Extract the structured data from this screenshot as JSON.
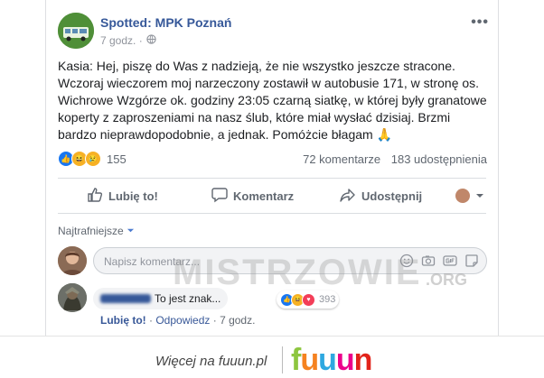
{
  "post": {
    "page_name": "Spotted: MPK Poznań",
    "time": "7 godz. ·",
    "more": "•••",
    "text": "Kasia: Hej, piszę do Was z nadzieją, że nie wszystko jeszcze stracone. Wczoraj wieczorem moj narzeczony zostawił w autobusie 171, w stronę os. Wichrowe Wzgórze ok. godziny 23:05 czarną siatkę, w której były granatowe koperty z zaproszeniami na nasz ślub, które miał wysłać dzisiaj. Brzmi bardzo nieprawdopodobnie, a jednak. Pomóżcie błagam 🙏"
  },
  "stats": {
    "reaction_count": "155",
    "comments": "72 komentarze",
    "shares": "183 udostępnienia"
  },
  "actions": {
    "like": "Lubię to!",
    "comment": "Komentarz",
    "share": "Udostępnij"
  },
  "comments": {
    "sort_label": "Najtrafniejsze",
    "input_placeholder": "Napisz komentarz...",
    "items": [
      {
        "text": "To jest znak...",
        "reaction_count": "393",
        "like": "Lubię to!",
        "reply": "Odpowiedz",
        "time": "7 godz."
      }
    ]
  },
  "footer": {
    "more_on": "Więcej na fuuun.pl",
    "brand_letters": [
      "f",
      "u",
      "u",
      "u",
      "n"
    ],
    "brand_colors": [
      "#8dc63f",
      "#f58220",
      "#2ea8e0",
      "#ec008c",
      "#e2231a"
    ]
  },
  "watermark": {
    "text": "MISTRZOWIE",
    "suffix": ".ORG"
  },
  "colors": {
    "link_blue": "#365899",
    "like_blue": "#1877f2",
    "love_red": "#f33e58",
    "haha_yellow": "#f7b125"
  }
}
